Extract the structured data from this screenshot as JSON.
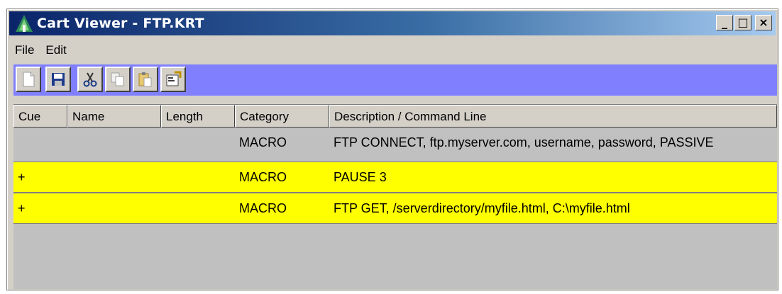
{
  "window": {
    "title": "Cart Viewer - FTP.KRT",
    "icon": "antenna-icon",
    "caption_buttons": {
      "minimize": "_",
      "maximize": "□",
      "close": "×"
    }
  },
  "menubar": {
    "items": [
      "File",
      "Edit"
    ]
  },
  "toolbar": {
    "background": "#8080ff",
    "buttons": [
      "new-document-icon",
      "save-icon",
      "cut-icon",
      "copy-icon",
      "paste-icon",
      "properties-icon"
    ]
  },
  "table": {
    "columns": [
      "Cue",
      "Name",
      "Length",
      "Category",
      "Description / Command Line"
    ],
    "rows": [
      {
        "cue": "",
        "name": "",
        "length": "",
        "category": "MACRO",
        "description": "FTP CONNECT, ftp.myserver.com, username, password, PASSIVE",
        "highlight": false
      },
      {
        "cue": "+",
        "name": "",
        "length": "",
        "category": "MACRO",
        "description": "PAUSE 3",
        "highlight": true
      },
      {
        "cue": "+",
        "name": "",
        "length": "",
        "category": "MACRO",
        "description": "FTP GET, /serverdirectory/myfile.html, C:\\myfile.html",
        "highlight": true
      }
    ],
    "highlight_color": "#ffff00"
  }
}
